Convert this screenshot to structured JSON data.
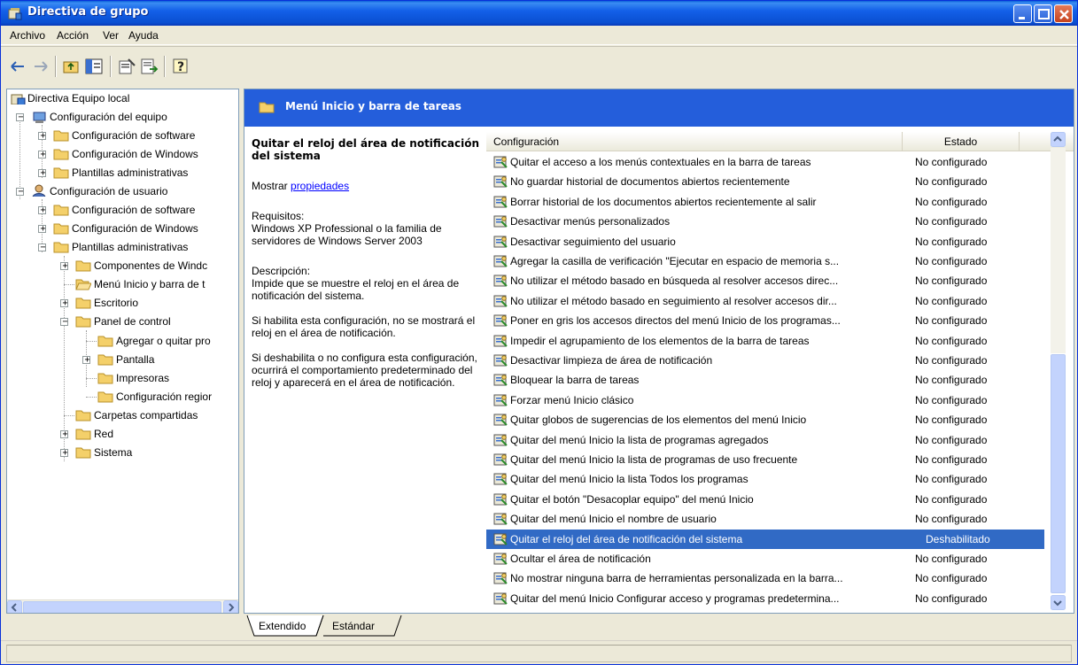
{
  "window": {
    "title": "Directiva de grupo"
  },
  "menu": [
    "Archivo",
    "Acción",
    "Ver",
    "Ayuda"
  ],
  "tree": {
    "items": [
      {
        "label": "Directiva Equipo local"
      },
      {
        "label": "Configuración del equipo"
      },
      {
        "label": "Configuración de software"
      },
      {
        "label": "Configuración de Windows"
      },
      {
        "label": "Plantillas administrativas"
      },
      {
        "label": "Configuración de usuario"
      },
      {
        "label": "Configuración de software"
      },
      {
        "label": "Configuración de Windows"
      },
      {
        "label": "Plantillas administrativas"
      },
      {
        "label": "Componentes de Windc"
      },
      {
        "label": "Menú Inicio y barra de t"
      },
      {
        "label": "Escritorio"
      },
      {
        "label": "Panel de control"
      },
      {
        "label": "Agregar o quitar pro"
      },
      {
        "label": "Pantalla"
      },
      {
        "label": "Impresoras"
      },
      {
        "label": "Configuración regior"
      },
      {
        "label": "Carpetas compartidas"
      },
      {
        "label": "Red"
      },
      {
        "label": "Sistema"
      }
    ]
  },
  "pane": {
    "title": "Menú Inicio y barra de tareas"
  },
  "description": {
    "title": "Quitar el reloj del área de notificación del sistema",
    "show_prefix": "Mostrar ",
    "show_link": "propiedades",
    "req_label": "Requisitos:",
    "req_text": "Windows XP Professional o la familia de servidores de Windows Server 2003",
    "desc_label": "Descripción:",
    "desc_text": "Impide que se muestre el reloj en el área de notificación del sistema.",
    "para2": "Si habilita esta configuración, no se mostrará el reloj en el área de notificación.",
    "para3": "Si deshabilita o no configura esta configuración, ocurrirá el comportamiento predeterminado del reloj y aparecerá en el área de notificación."
  },
  "list": {
    "columns": [
      "Configuración",
      "Estado"
    ],
    "rows": [
      {
        "name": "Quitar el acceso a los menús contextuales en la barra de tareas",
        "state": "No configurado"
      },
      {
        "name": "No guardar historial de documentos abiertos recientemente",
        "state": "No configurado"
      },
      {
        "name": "Borrar historial de los documentos abiertos recientemente al salir",
        "state": "No configurado"
      },
      {
        "name": "Desactivar menús personalizados",
        "state": "No configurado"
      },
      {
        "name": "Desactivar seguimiento del usuario",
        "state": "No configurado"
      },
      {
        "name": "Agregar la casilla de verificación \"Ejecutar en espacio de memoria s...",
        "state": "No configurado"
      },
      {
        "name": "No utilizar el método basado en búsqueda al resolver accesos direc...",
        "state": "No configurado"
      },
      {
        "name": "No utilizar el método basado en seguimiento al resolver accesos dir...",
        "state": "No configurado"
      },
      {
        "name": "Poner en gris los accesos directos del menú Inicio de los programas...",
        "state": "No configurado"
      },
      {
        "name": "Impedir el agrupamiento de los elementos de la barra de tareas",
        "state": "No configurado"
      },
      {
        "name": "Desactivar limpieza de área de notificación",
        "state": "No configurado"
      },
      {
        "name": "Bloquear la barra de tareas",
        "state": "No configurado"
      },
      {
        "name": "Forzar menú Inicio clásico",
        "state": "No configurado"
      },
      {
        "name": "Quitar globos de sugerencias de los elementos del menú Inicio",
        "state": "No configurado"
      },
      {
        "name": "Quitar del menú Inicio la lista de programas agregados",
        "state": "No configurado"
      },
      {
        "name": " Quitar del menú Inicio la lista de programas de uso frecuente",
        "state": "No configurado"
      },
      {
        "name": "Quitar del menú Inicio la lista Todos los programas",
        "state": "No configurado"
      },
      {
        "name": "Quitar el botón \"Desacoplar equipo\" del menú Inicio",
        "state": "No configurado"
      },
      {
        "name": "Quitar del menú Inicio el nombre de usuario",
        "state": "No configurado"
      },
      {
        "name": "Quitar el reloj del área de notificación del sistema",
        "state": "Deshabilitado"
      },
      {
        "name": "Ocultar el área de notificación",
        "state": "No configurado"
      },
      {
        "name": "No mostrar ninguna barra de herramientas personalizada en la barra...",
        "state": "No configurado"
      },
      {
        "name": "Quitar del menú Inicio Configurar acceso y programas predetermina...",
        "state": "No configurado"
      }
    ]
  },
  "tabs": [
    "Extendido",
    "Estándar"
  ],
  "colors": {
    "titlebar": "#0a4fd1",
    "pane_header": "#245edb",
    "selection": "#316ac5",
    "folder": "#f4d06a"
  }
}
